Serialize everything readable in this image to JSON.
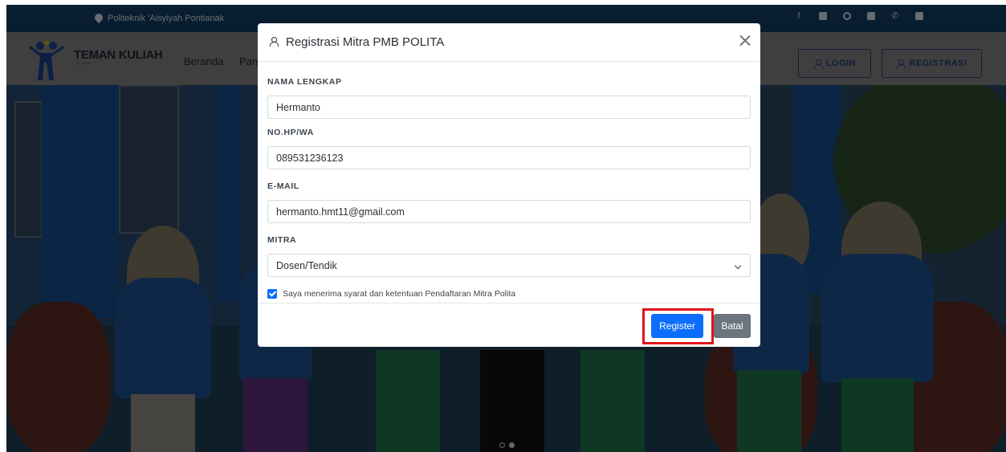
{
  "topbar": {
    "location": "Politeknik 'Aisyiyah Pontianak",
    "social_icons": [
      "facebook-icon",
      "youtube-icon",
      "whatsapp-icon",
      "instagram-icon",
      "phone-icon",
      "mail-icon"
    ]
  },
  "navbar": {
    "brand": "TEMAN KULIAH",
    "brand_sub": "By Polita",
    "links": [
      "Beranda",
      "Pan"
    ],
    "login_label": "LOGIN",
    "register_label": "REGISTRASI"
  },
  "modal": {
    "title": "Registrasi Mitra PMB POLITA",
    "fields": {
      "nama_label": "NAMA LENGKAP",
      "nama_value": "Hermanto",
      "hp_label": "NO.HP/WA",
      "hp_value": "089531236123",
      "email_label": "E-MAIL",
      "email_value": "hermanto.hmt11@gmail.com",
      "mitra_label": "MITRA",
      "mitra_value": "Dosen/Tendik"
    },
    "terms_label": "Saya menerima syarat dan ketentuan Pendaftaran Mitra Polita",
    "terms_checked": true,
    "register_button": "Register",
    "cancel_button": "Batal"
  },
  "colors": {
    "topbar": "#123a61",
    "primary": "#0d6efd",
    "secondary": "#6c757d",
    "highlight": "#e0141b"
  }
}
